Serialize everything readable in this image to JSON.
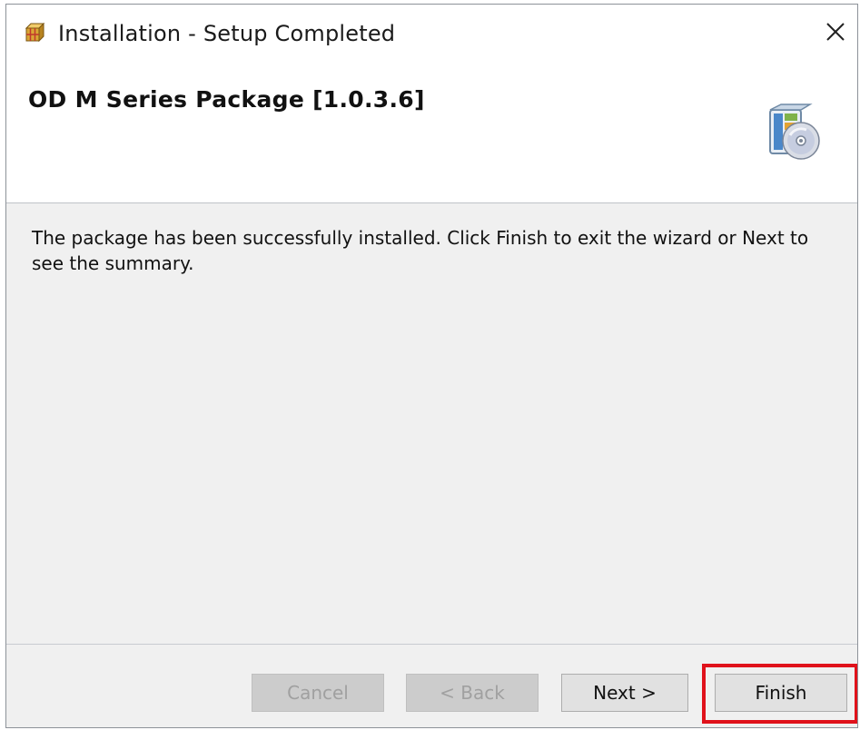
{
  "window": {
    "title": "Installation - Setup Completed",
    "icon": "installer-box-icon",
    "close_icon": "close-icon"
  },
  "header": {
    "package_title": "OD M Series Package [1.0.3.6]",
    "icon": "package-disc-icon"
  },
  "content": {
    "message": "The package has been successfully installed. Click Finish to exit the wizard or Next to see the summary."
  },
  "buttons": {
    "cancel": "Cancel",
    "back": "< Back",
    "next": "Next >",
    "finish": "Finish"
  },
  "colors": {
    "highlight": "#e0121b",
    "content_bg": "#f0f0f0"
  }
}
